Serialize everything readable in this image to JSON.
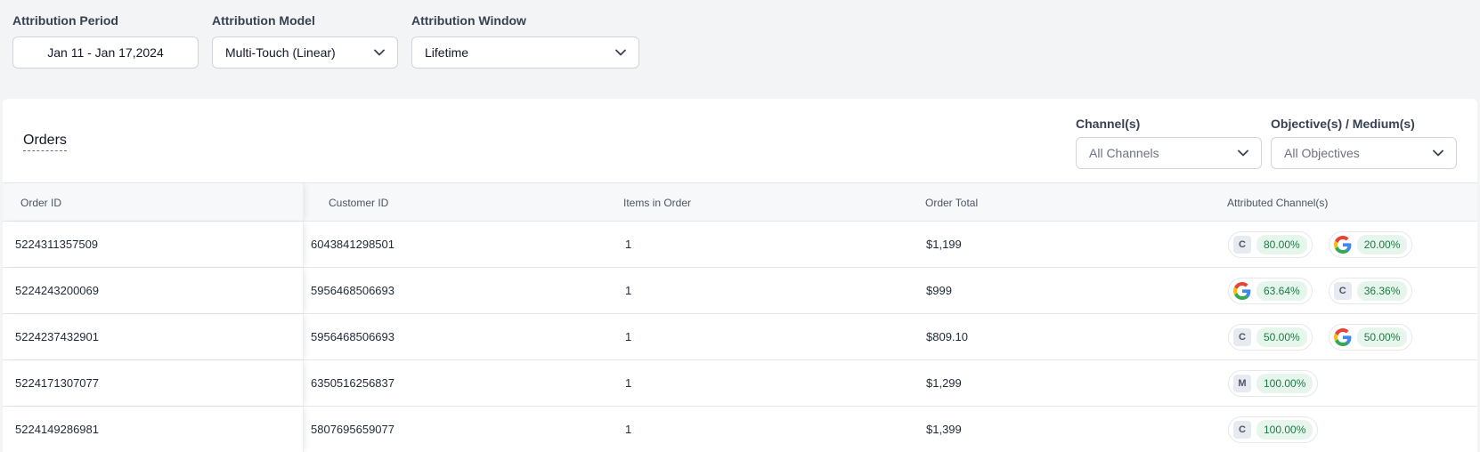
{
  "filters": {
    "period": {
      "label": "Attribution Period",
      "value": "Jan 11 - Jan 17,2024"
    },
    "model": {
      "label": "Attribution Model",
      "value": "Multi-Touch (Linear)"
    },
    "window": {
      "label": "Attribution Window",
      "value": "Lifetime"
    }
  },
  "card": {
    "title": "Orders",
    "channels": {
      "label": "Channel(s)",
      "value": "All Channels"
    },
    "objectives": {
      "label": "Objective(s) / Medium(s)",
      "value": "All Objectives"
    }
  },
  "table": {
    "columns": [
      "Order ID",
      "Customer ID",
      "Items in Order",
      "Order Total",
      "Attributed Channel(s)"
    ],
    "rows": [
      {
        "order_id": "5224311357509",
        "customer_id": "6043841298501",
        "items": "1",
        "total": "$1,199",
        "channels": [
          {
            "icon": "C",
            "value": "80.00%"
          },
          {
            "icon": "google",
            "value": "20.00%"
          }
        ]
      },
      {
        "order_id": "5224243200069",
        "customer_id": "5956468506693",
        "items": "1",
        "total": "$999",
        "channels": [
          {
            "icon": "google",
            "value": "63.64%"
          },
          {
            "icon": "C",
            "value": "36.36%"
          }
        ]
      },
      {
        "order_id": "5224237432901",
        "customer_id": "5956468506693",
        "items": "1",
        "total": "$809.10",
        "channels": [
          {
            "icon": "C",
            "value": "50.00%"
          },
          {
            "icon": "google",
            "value": "50.00%"
          }
        ]
      },
      {
        "order_id": "5224171307077",
        "customer_id": "6350516256837",
        "items": "1",
        "total": "$1,299",
        "channels": [
          {
            "icon": "M",
            "value": "100.00%"
          }
        ]
      },
      {
        "order_id": "5224149286981",
        "customer_id": "5807695659077",
        "items": "1",
        "total": "$1,399",
        "channels": [
          {
            "icon": "C",
            "value": "100.00%"
          }
        ]
      }
    ]
  },
  "colors": {
    "page_bg": "#f3f4f6",
    "chip_value_bg": "#e7f6ec",
    "chip_value_text": "#1d7a44",
    "google_blue": "#4285F4",
    "google_red": "#EA4335",
    "google_yellow": "#FBBC05",
    "google_green": "#34A853"
  }
}
